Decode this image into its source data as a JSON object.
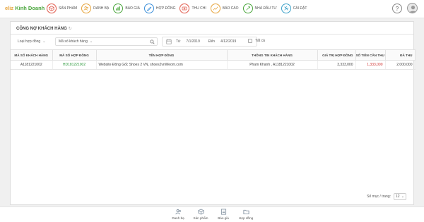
{
  "brand": {
    "part1": "eliz",
    "part2": "Kinh Doanh"
  },
  "nav": [
    {
      "label": "Sản phẩm",
      "icon": "box-icon",
      "color": "#e0584a"
    },
    {
      "label": "Danh bạ",
      "icon": "contacts-icon",
      "color": "#e6a33a"
    },
    {
      "label": "Báo giá",
      "icon": "quote-icon",
      "color": "#4aa63c"
    },
    {
      "label": "Hợp đồng",
      "icon": "contract-icon",
      "color": "#3b8fd9"
    },
    {
      "label": "Thu chi",
      "icon": "cash-icon",
      "color": "#e0584a"
    },
    {
      "label": "Báo cáo",
      "icon": "report-icon",
      "color": "#e6a33a"
    },
    {
      "label": "Nhà đầu tư",
      "icon": "investor-icon",
      "color": "#4aa63c"
    },
    {
      "label": "Cài đặt",
      "icon": "settings-icon",
      "color": "#3aa0c8"
    }
  ],
  "help_label": "?",
  "panel": {
    "title": "Công nợ khách hàng",
    "refresh_icon": "refresh-icon"
  },
  "filters": {
    "contract_type": "Loại hợp đồng",
    "customer_code": "Mã số khách hàng",
    "from_label": "Từ",
    "from_date": "7/1/2019",
    "to_label": "Đến",
    "to_date": "4/12/2019",
    "all_label": "Tất cả"
  },
  "table": {
    "columns": [
      "Mã số khách hàng",
      "Mã số hợp đồng",
      "Tên hợp đồng",
      "Thông tin khách hàng",
      "Giá trị hợp đồng",
      "Số tiền cần thu",
      "Đã thu"
    ],
    "rows": [
      [
        "A1181221002",
        "HD181221002",
        "Website Đông Gốc Shoes 2 VN, shoes2vnWeom.com",
        "Pham Khanh , A1181221002",
        "3,333,000",
        "1,333,000",
        "2,000,000"
      ]
    ]
  },
  "pager": {
    "label": "Số mục / trang:",
    "value": "12"
  },
  "bottom_nav": [
    {
      "label": "Danh bạ",
      "icon": "contacts-icon"
    },
    {
      "label": "Sản phẩm",
      "icon": "box-icon"
    },
    {
      "label": "Báo giá",
      "icon": "quote-icon"
    },
    {
      "label": "Hợp đồng",
      "icon": "folder-icon"
    }
  ]
}
